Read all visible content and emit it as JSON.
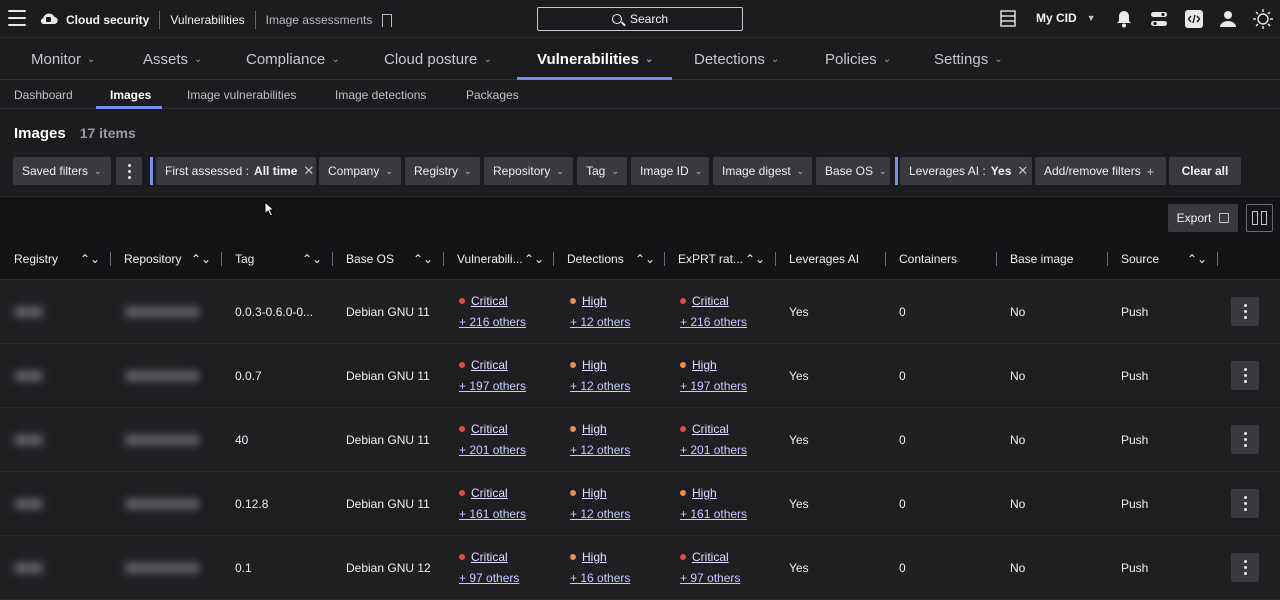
{
  "breadcrumb": {
    "app": "Cloud security",
    "section": "Vulnerabilities",
    "page": "Image assessments"
  },
  "search": {
    "label": "Search"
  },
  "account": {
    "label": "My CID"
  },
  "main_nav": [
    {
      "label": "Monitor"
    },
    {
      "label": "Assets"
    },
    {
      "label": "Compliance"
    },
    {
      "label": "Cloud posture"
    },
    {
      "label": "Vulnerabilities",
      "active": true
    },
    {
      "label": "Detections"
    },
    {
      "label": "Policies"
    },
    {
      "label": "Settings"
    }
  ],
  "sub_nav": [
    {
      "label": "Dashboard"
    },
    {
      "label": "Images",
      "active": true
    },
    {
      "label": "Image vulnerabilities"
    },
    {
      "label": "Image detections"
    },
    {
      "label": "Packages"
    }
  ],
  "page": {
    "title": "Images",
    "count": "17 items"
  },
  "filters": {
    "saved": "Saved filters",
    "first_assessed_label": "First assessed :",
    "first_assessed_value": "All time",
    "company": "Company",
    "registry": "Registry",
    "repository": "Repository",
    "tag": "Tag",
    "image_id": "Image ID",
    "image_digest": "Image digest",
    "base_os": "Base OS",
    "leverages_label": "Leverages AI :",
    "leverages_value": "Yes",
    "add_remove": "Add/remove filters",
    "clear_all": "Clear all"
  },
  "toolbar": {
    "export": "Export"
  },
  "columns": [
    "Registry",
    "Repository",
    "Tag",
    "Base OS",
    "Vulnerabili...",
    "Detections",
    "ExPRT rat...",
    "Leverages AI",
    "Containers",
    "Base image",
    "Source"
  ],
  "rows": [
    {
      "tag": "0.0.3-0.6.0-0...",
      "base_os": "Debian GNU 11",
      "vuln": "Critical",
      "vuln_more": "+ 216 others",
      "det": "High",
      "det_more": "+ 12 others",
      "exprt": "Critical",
      "exprt_more": "+ 216 others",
      "ai": "Yes",
      "containers": "0",
      "base_image": "No",
      "source": "Push"
    },
    {
      "tag": "0.0.7",
      "base_os": "Debian GNU 11",
      "vuln": "Critical",
      "vuln_more": "+ 197 others",
      "det": "High",
      "det_more": "+ 12 others",
      "exprt": "High",
      "exprt_more": "+ 197 others",
      "ai": "Yes",
      "containers": "0",
      "base_image": "No",
      "source": "Push"
    },
    {
      "tag": "40",
      "base_os": "Debian GNU 11",
      "vuln": "Critical",
      "vuln_more": "+ 201 others",
      "det": "High",
      "det_more": "+ 12 others",
      "exprt": "Critical",
      "exprt_more": "+ 201 others",
      "ai": "Yes",
      "containers": "0",
      "base_image": "No",
      "source": "Push"
    },
    {
      "tag": "0.12.8",
      "base_os": "Debian GNU 11",
      "vuln": "Critical",
      "vuln_more": "+ 161 others",
      "det": "High",
      "det_more": "+ 12 others",
      "exprt": "High",
      "exprt_more": "+ 161 others",
      "ai": "Yes",
      "containers": "0",
      "base_image": "No",
      "source": "Push"
    },
    {
      "tag": "0.1",
      "base_os": "Debian GNU 12",
      "vuln": "Critical",
      "vuln_more": "+ 97 others",
      "det": "High",
      "det_more": "+ 16 others",
      "exprt": "Critical",
      "exprt_more": "+ 97 others",
      "ai": "Yes",
      "containers": "0",
      "base_image": "No",
      "source": "Push"
    }
  ],
  "colors": {
    "accent": "#7b8df0",
    "critical": "#e5484d",
    "high": "#f5884a"
  },
  "icons": [
    "menu-icon",
    "cloud-icon",
    "bookmark-icon",
    "search-icon",
    "layout-icon",
    "bell-icon",
    "switch-icon",
    "code-icon",
    "user-icon",
    "sun-icon",
    "external-link-icon",
    "columns-icon",
    "kebab-icon"
  ]
}
